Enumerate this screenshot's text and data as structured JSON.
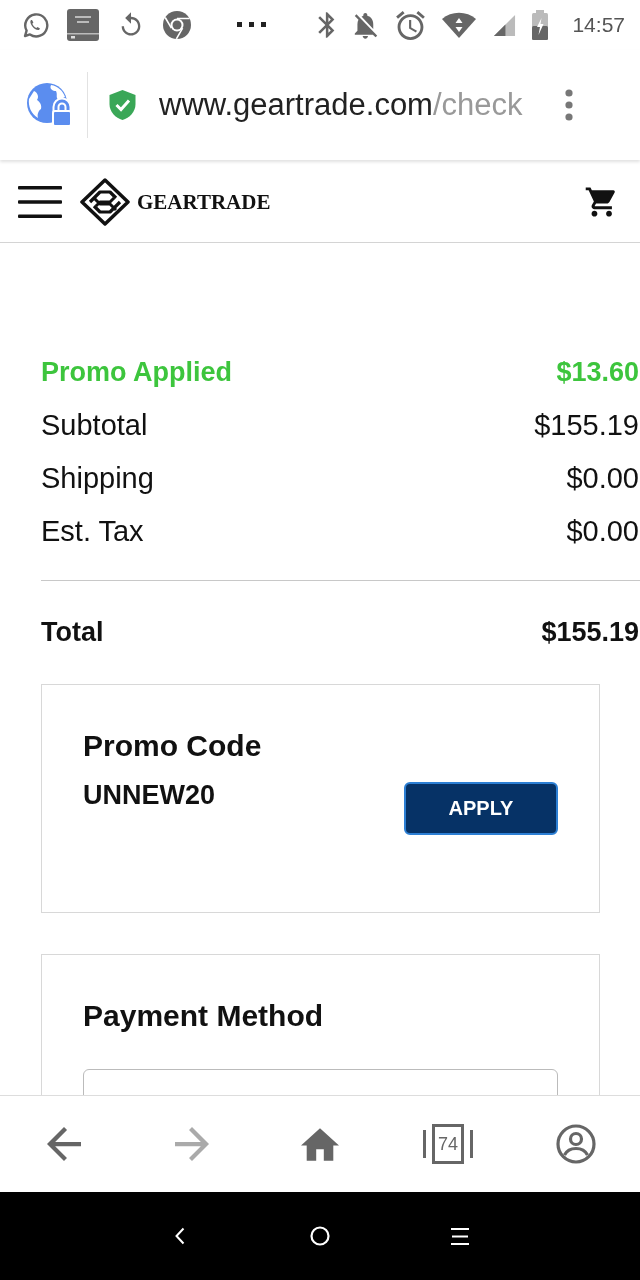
{
  "status_bar": {
    "time": "14:57"
  },
  "address_bar": {
    "domain": "www.geartrade.com",
    "path": "/check"
  },
  "site_header": {
    "brand": "GEARTRADE"
  },
  "order_summary": {
    "lines": [
      {
        "kind": "discount",
        "label": "Promo Applied",
        "value": "$13.60"
      },
      {
        "kind": "charge",
        "label": "Subtotal",
        "value": "$155.19"
      },
      {
        "kind": "charge",
        "label": "Shipping",
        "value": "$0.00"
      },
      {
        "kind": "charge",
        "label": "Est. Tax",
        "value": "$0.00"
      }
    ],
    "total": {
      "label": "Total",
      "value": "$155.19"
    }
  },
  "promo_code": {
    "title": "Promo Code",
    "value": "UNNEW20",
    "button": "APPLY"
  },
  "payment_method": {
    "title": "Payment Method"
  },
  "browser_toolbar": {
    "buttons": [
      {
        "kind": "back",
        "disabled": false
      },
      {
        "kind": "forward",
        "disabled": true
      },
      {
        "kind": "home",
        "disabled": false
      },
      {
        "kind": "tabs",
        "count": "74",
        "disabled": false
      },
      {
        "kind": "account",
        "disabled": false
      }
    ]
  }
}
